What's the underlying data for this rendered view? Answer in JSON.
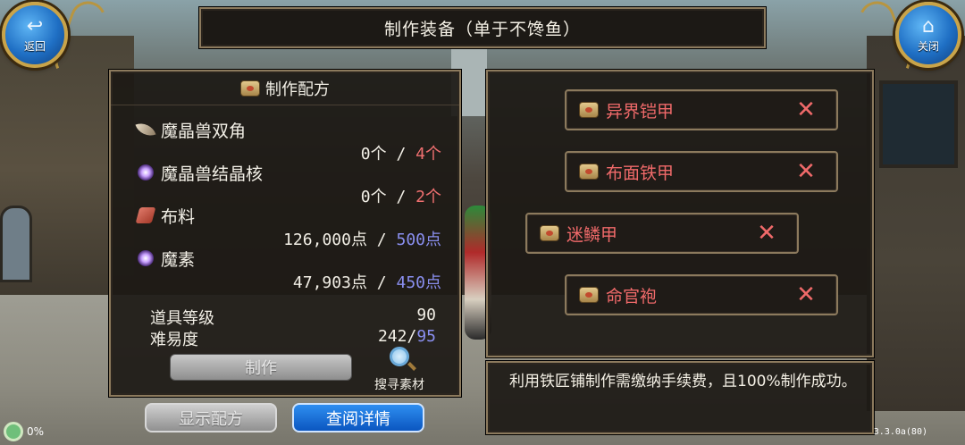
{
  "header": {
    "back_label": "返回",
    "close_label": "关闭",
    "title": "制作装备（单于不馋鱼）"
  },
  "recipe": {
    "title": "制作配方",
    "materials": [
      {
        "name": "魔晶兽双角",
        "have": "0个",
        "need": "4个",
        "icon": "horn-icon"
      },
      {
        "name": "魔晶兽结晶核",
        "have": "0个",
        "need": "2个",
        "icon": "crystal-orb-icon"
      },
      {
        "name": "布料",
        "have": "126,000点",
        "need": "500点",
        "icon": "cloth-icon"
      },
      {
        "name": "魔素",
        "have": "47,903点",
        "need": "450点",
        "icon": "mana-orb-icon"
      }
    ],
    "separator": "/",
    "item_level_label": "道具等级",
    "item_level_value": "90",
    "difficulty_label": "难易度",
    "difficulty_have": "242",
    "difficulty_need": "95",
    "craft_label": "制作",
    "search_label": "搜寻素材"
  },
  "buttons": {
    "show_recipe": "显示配方",
    "view_detail": "查阅详情"
  },
  "equipment_list": [
    {
      "name": "异界铠甲"
    },
    {
      "name": "布面铁甲"
    },
    {
      "name": "迷鳞甲"
    },
    {
      "name": "命官袍"
    }
  ],
  "description": "利用铁匠铺制作需缴纳手续费，且100%制作成功。",
  "status": {
    "progress": "0%",
    "version": "3.3.0a(80)"
  },
  "colors": {
    "need_insufficient": "#f07070",
    "need_sufficient": "#8a8ff0",
    "item_name": "#f06a6a",
    "primary_button": "#1a6fd8"
  }
}
